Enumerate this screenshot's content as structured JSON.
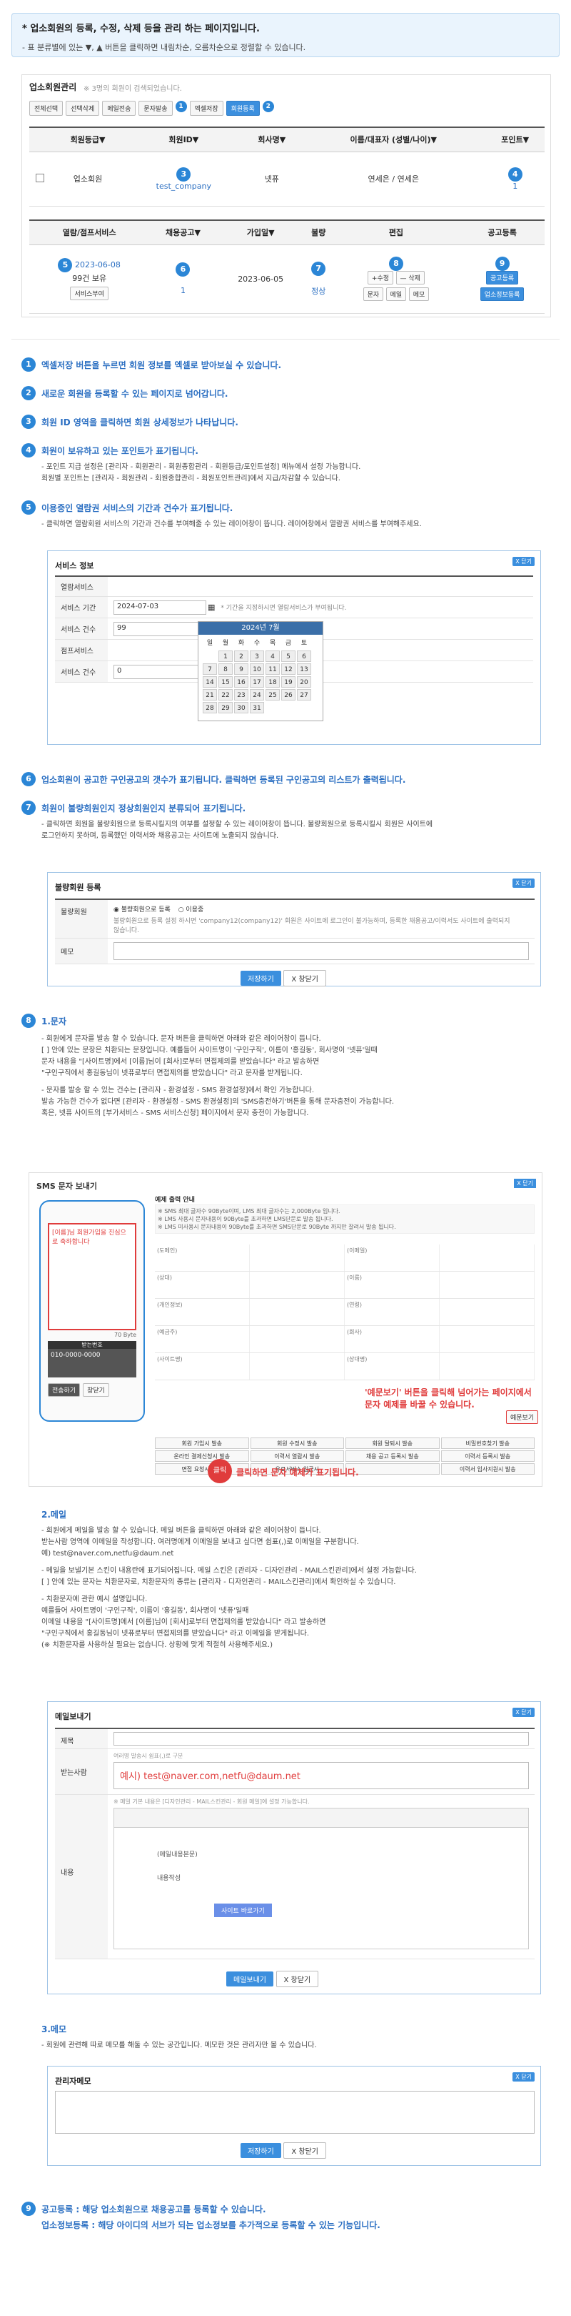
{
  "header": {
    "title": "* 업소회원의 등록, 수정, 삭제 등을 관리 하는 페이지입니다.",
    "subtitle": "- 표 분류별에 있는 ▼, ▲ 버튼을 클릭하면 내림차순, 오름차순으로 정렬할 수 있습니다."
  },
  "panel": {
    "title": "업소회원관리",
    "count_text": "※ 3명의 회원이 검색되었습니다.",
    "buttons": [
      "전체선택",
      "선택삭제",
      "메일전송",
      "문자발송",
      "엑셀저장",
      "회원등록"
    ],
    "step1": "1",
    "step2": "2"
  },
  "table1": {
    "headers": [
      "회원등급▼",
      "회원ID▼",
      "회사명▼",
      "이름/대표자 (성별/나이)▼",
      "포인트▼"
    ],
    "row": {
      "grade": "업소회원",
      "id": "test_company",
      "company": "넷퓨",
      "name": "연세은 / 연세은",
      "points": "1"
    },
    "step3": "3",
    "step4": "4"
  },
  "table2": {
    "headers": [
      "열람/점프서비스",
      "채용공고▼",
      "가입일▼",
      "불량",
      "편집",
      "공고등록"
    ],
    "row": {
      "service_date": "2023-06-08",
      "service_count": "99건 보유",
      "service_btn": "서비스부여",
      "jobs": "1",
      "joined": "2023-06-05",
      "bad": "정상",
      "edit_btns": [
        "+수정",
        "— 삭제",
        "문자",
        "메일",
        "메모"
      ],
      "post_btns": [
        "공고등록",
        "업소정보등록"
      ]
    },
    "steps": [
      "5",
      "6",
      "7",
      "8",
      "9"
    ]
  },
  "sections": [
    {
      "n": "1",
      "t": "엑셀저장 버튼을 누르면 회원 정보를 엑셀로 받아보실 수 있습니다."
    },
    {
      "n": "2",
      "t": "새로운 회원을 등록할 수 있는 페이지로 넘어갑니다."
    },
    {
      "n": "3",
      "t": "회원 ID 영역을 클릭하면 회원 상세정보가 나타납니다."
    },
    {
      "n": "4",
      "t": "회원이 보유하고 있는 포인트가 표기됩니다."
    },
    {
      "n": "5",
      "t": "이용중인 열람권 서비스의 기간과 건수가 표기됩니다."
    },
    {
      "n": "6",
      "t": "업소회원이 공고한 구인공고의 갯수가 표기됩니다. 클릭하면 등록된 구인공고의 리스트가 출력됩니다."
    },
    {
      "n": "7",
      "t": "회원이 불량회원인지 정상회원인지 분류되어 표기됩니다."
    },
    {
      "n": "8",
      "t": "1.문자"
    },
    {
      "n": "9",
      "t": "공고등록 : 해당 업소회원으로 채용공고를 등록할 수 있습니다."
    }
  ],
  "sec4_desc": [
    "- 포인트 지급 설정은 [관리자 - 회원관리 - 회원종합관리 - 회원등급/포인트설정] 메뉴에서 설정 가능합니다.",
    "  회원별 포인트는 [관리자 - 회원관리 - 회원종합관리 - 회원포인트관리]에서 지급/차감할 수 있습니다."
  ],
  "sec5_desc": "- 클릭하면 열람회원 서비스의 기간과 건수를 부여해줄 수 있는 레이어창이 뜹니다. 레이어창에서 열람권 서비스를 부여해주세요.",
  "svc_box": {
    "title": "서비스 정보",
    "close": "X 닫기",
    "row1": "열람서비스",
    "period_label": "서비스 기간",
    "period_value": "2024-07-03",
    "period_hint": "* 기간을 지정하시면 열람서비스가 부여됩니다.",
    "count_label": "서비스 건수",
    "count_value": "99",
    "count_unit": "건",
    "row4": "점프서비스",
    "count2_label": "서비스 건수",
    "count2_value": "0",
    "count2_unit": "건",
    "cal_title": "2024년 7월",
    "cal_days": [
      "일",
      "월",
      "화",
      "수",
      "목",
      "금",
      "토"
    ],
    "cal_dates": [
      "",
      "1",
      "2",
      "3",
      "4",
      "5",
      "6",
      "7",
      "8",
      "9",
      "10",
      "11",
      "12",
      "13",
      "14",
      "15",
      "16",
      "17",
      "18",
      "19",
      "20",
      "21",
      "22",
      "23",
      "24",
      "25",
      "26",
      "27",
      "28",
      "29",
      "30",
      "31"
    ]
  },
  "sec7_desc": [
    "- 클릭하면 회원을 불량회원으로 등록시킬지의 여부를 설정할 수 있는 레이어창이 뜹니다. 불량회원으로 등록시킬시 회원은 사이트에",
    "  로그인하지 못하며, 등록했던 이력서와 채용공고는 사이트에 노출되지 않습니다."
  ],
  "bad_box": {
    "title": "불량회원 등록",
    "close": "X 닫기",
    "label": "불량회원",
    "opt1": "불량회원으로 등록",
    "opt2": "이용중",
    "note": "불량회원으로 등록 설정 하시면 'company12(company12)' 회원은 사이트에 로그인이 불가능하며, 등록한 채용공고/이력서도 사이트에 출력되지 않습니다.",
    "memo_label": "메모",
    "submit": "저장하기",
    "cancel": "X 창닫기"
  },
  "sec8_desc": [
    "- 회원에게 문자를 발송 할 수 있습니다. 문자 버튼을 클릭하면 아래와 같은 레이어창이 뜹니다.",
    "  [ ] 안에 있는 문장은 치환되는 문장입니다. 예를들어 사이트명이 '구인구직', 이름이 '홍길동', 회사명이 '넷퓨'일때",
    "  문자 내용을 \"[사이트명]에서 [이름]님이 [회사]로부터 면접제의를 받았습니다\" 라고 발송하면",
    "  \"구인구직에서 홍길동님이 넷퓨로부터 면접제의를 받았습니다\" 라고 문자를 받게됩니다.",
    "",
    "- 문자를 발송 할 수 있는 건수는 [관리자 - 환경설정 - SMS 환경설정]에서 확인 가능합니다.",
    "  발송 가능한 건수가 없다면 [관리자 - 환경설정 - SMS 환경설정]의 'SMS충전하기'버튼을 통해 문자충전이 가능합니다.",
    "  혹은, 넷퓨 사이트의 [부가서비스 - SMS 서비스신청] 페이지에서 문자 충전이 가능합니다."
  ],
  "sms_box": {
    "title": "SMS 문자 보내기",
    "close": "X 닫기",
    "phone_text": "[이름]님 회원가입을 진심으로 축하합니다",
    "bytes": "70 Byte",
    "recv_label": "받는번호",
    "recv_value": "010-0000-0000",
    "send_btn": "전송하기",
    "cancel_btn": "창닫기",
    "info_title": "예제 출력 안내",
    "info_lines": [
      "※ SMS 최대 글자수 90Byte이며, LMS 최대 글자수는 2,000Byte 입니다.",
      "※ LMS 사용시 문자내용이 90Byte를 초과하면 LMS단문로 발송 됩니다.",
      "※ LMS 미사용시 문자내용이 90Byte를 초과하면 SMS단문로 90Byte 까지만 잘려서 발송 됩니다."
    ],
    "cells": [
      "(도메인)",
      "(이메일)",
      "(상대)",
      "(이름)",
      "(개인정보)",
      "(연령)",
      "(예금주)",
      "(회사)",
      "(사이트명)",
      "(상대명)"
    ],
    "callout1": "'예문보기' 버튼을 클릭해 넘어가는 페이지에서",
    "callout1b": "문자 예제를 바꿀 수 있습니다.",
    "callout_btn": "예문보기",
    "callout2": "클릭하면 문자 예제가 표기됩니다.",
    "click_label": "클릭",
    "btns": [
      "회원 가입시 발송",
      "회원 수정시 발송",
      "회원 탈퇴시 발송",
      "비밀번호찾기 발송",
      "온라인 결제신청시 발송",
      "이력서 열람시 발송",
      "채용 공고 등록시 발송",
      "이력서 등록시 발송",
      "면접 요청시 발송",
      "유료서비스 입금시",
      "",
      "이력서 입사지원시 발송"
    ]
  },
  "mail_intro": "2.메일",
  "mail_desc": [
    "- 회원에게 메일을 발송 할 수 있습니다. 메일 버튼을 클릭하면 아래와 같은 레이어창이 뜹니다.",
    "  받는사람 영역에 이메일을 작성합니다. 여러명에게 이메일을 보내고 싶다면 쉼표(,)로 이메일을 구분합니다.",
    "  예) test@naver.com,netfu@daum.net",
    "",
    "- 메일을 보낼기본 스킨이 내용란에 표기되어집니다. 메일 스킨은 [관리자 - 디자인관리 - MAIL스킨관리]에서 설정 가능합니다.",
    "  [ ] 안에 있는 문자는 치환문자로, 치환문자의 종류는 [관리자 - 디자인관리 - MAIL스킨관리]에서 확인하실 수 있습니다.",
    "",
    "- 치환문자에 관한 예시 설명입니다.",
    "  예를들어 사이트명이 '구인구직', 이름이 '홍길동', 회사명이 '넷퓨'일때",
    "  이메일 내용을 \"[사이트명]에서 [이름]님이 [회사]로부터 면접제의를 받았습니다\" 라고 발송하면",
    "  \"구인구직에서 홍길동님이 넷퓨로부터 면접제의를 받았습니다\" 라고 이메일을 받게됩니다.",
    "  (※ 치환문자를 사용하실 필요는 없습니다. 상황에 맞게 적절히 사용해주세요.)"
  ],
  "mail_box": {
    "title": "메일보내기",
    "close": "X 닫기",
    "subject_label": "제목",
    "to_label": "받는사람",
    "to_hint": "여러명 발송시 쉼표(,)로 구분",
    "to_example": "예시) test@naver.com,netfu@daum.net",
    "body_label": "내용",
    "body_hint": "※ 메일 기본 내용은 [디자인관리 - MAIL스킨관리 - 회원 메일]에 설정 가능합니다.",
    "body_placeholder": "(메일내용본문)",
    "body_sub": "내용작성",
    "site_btn": "사이트 바로가기",
    "submit": "메일보내기",
    "cancel": "X 창닫기"
  },
  "memo_intro": "3.메모",
  "memo_desc": "- 회원에 관련해 따로 메모를 해둘 수 있는 공간입니다. 메모한 것은 관리자만 볼 수 있습니다.",
  "memo_box": {
    "title": "관리자메모",
    "close": "X 닫기",
    "submit": "저장하기",
    "cancel": "X 창닫기"
  },
  "sec9_extra": "업소정보등록 : 해당 아이디의 서브가 되는 업소정보를 추가적으로 등록할 수 있는 기능입니다."
}
